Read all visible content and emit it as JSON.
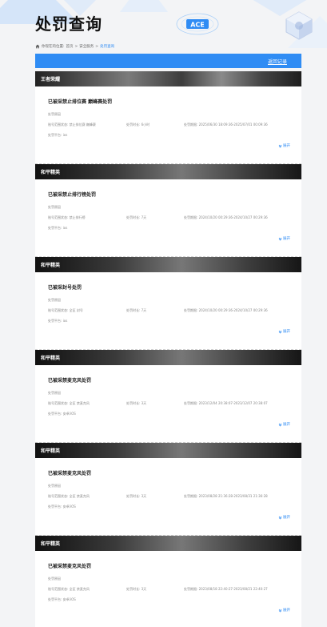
{
  "page": {
    "title": "处罚查询"
  },
  "breadcrumb": {
    "prefix": "你现在的位置:",
    "home": "首页",
    "sep1": ">",
    "section": "安全服务",
    "sep2": ">",
    "current": "处罚查询"
  },
  "toolbar": {
    "back_label": "返回记录"
  },
  "records": [
    {
      "game": "王者荣耀",
      "title": "已被采禁止排位赛 巅峰赛处罚",
      "info_label": "处罚原因",
      "account_label": "账号范围状态:",
      "account_value": "禁止排位赛 巅峰赛",
      "duration_label": "处罚时长:",
      "duration_value": "6小时",
      "period_label": "处罚期限:",
      "period_value": "2025/06/30 18:09:36-2025/07/01 00:09:36",
      "platform_label": "处罚平台:",
      "platform_value": "ios",
      "expand": "展开"
    },
    {
      "game": "和平精英",
      "title": "已被采禁止排行榜处罚",
      "info_label": "处罚原因",
      "account_label": "账号范围状态:",
      "account_value": "禁止排行榜",
      "duration_label": "处罚时长:",
      "duration_value": "7天",
      "period_label": "处罚期限:",
      "period_value": "2024/10/20 00:29:36-2024/10/27 00:29:36",
      "platform_label": "处罚平台:",
      "platform_value": "ios",
      "expand": "展开"
    },
    {
      "game": "和平精英",
      "title": "已被采封号处罚",
      "info_label": "处罚原因",
      "account_label": "账号范围状态:",
      "account_value": "全区 封号",
      "duration_label": "处罚时长:",
      "duration_value": "7天",
      "period_label": "处罚期限:",
      "period_value": "2024/10/20 00:29:36-2024/10/27 00:29:36",
      "platform_label": "处罚平台:",
      "platform_value": "ios",
      "expand": "展开"
    },
    {
      "game": "和平精英",
      "title": "已被采禁麦克风处罚",
      "info_label": "处罚原因",
      "account_label": "账号范围状态:",
      "account_value": "全区 禁麦克风",
      "duration_label": "处罚时长:",
      "duration_value": "3天",
      "period_label": "处罚期限:",
      "period_value": "2023/12/04 20:38:07-2023/12/07 20:38:07",
      "platform_label": "处罚平台:",
      "platform_value": "安卓/iOS",
      "expand": "展开"
    },
    {
      "game": "和平精英",
      "title": "已被采禁麦克风处罚",
      "info_label": "处罚原因",
      "account_label": "账号范围状态:",
      "account_value": "全区 禁麦克风",
      "duration_label": "处罚时长:",
      "duration_value": "3天",
      "period_label": "处罚期限:",
      "period_value": "2023/08/28 21:36:28-2023/08/31 21:36:28",
      "platform_label": "处罚平台:",
      "platform_value": "安卓/iOS",
      "expand": "展开"
    },
    {
      "game": "和平精英",
      "title": "已被采禁麦克风处罚",
      "info_label": "处罚原因",
      "account_label": "账号范围状态:",
      "account_value": "全区 禁麦克风",
      "duration_label": "处罚时长:",
      "duration_value": "3天",
      "period_label": "处罚期限:",
      "period_value": "2023/08/18 22:40:27-2023/08/21 22:40:27",
      "platform_label": "处罚平台:",
      "platform_value": "安卓/iOS",
      "expand": "展开"
    }
  ],
  "colors": {
    "accent": "#2f8cf4",
    "banner_dark": "#1a1a1a",
    "card_bg": "#ffffff",
    "page_bg": "#f3f4f6"
  },
  "logo": {
    "text": "ACE"
  }
}
